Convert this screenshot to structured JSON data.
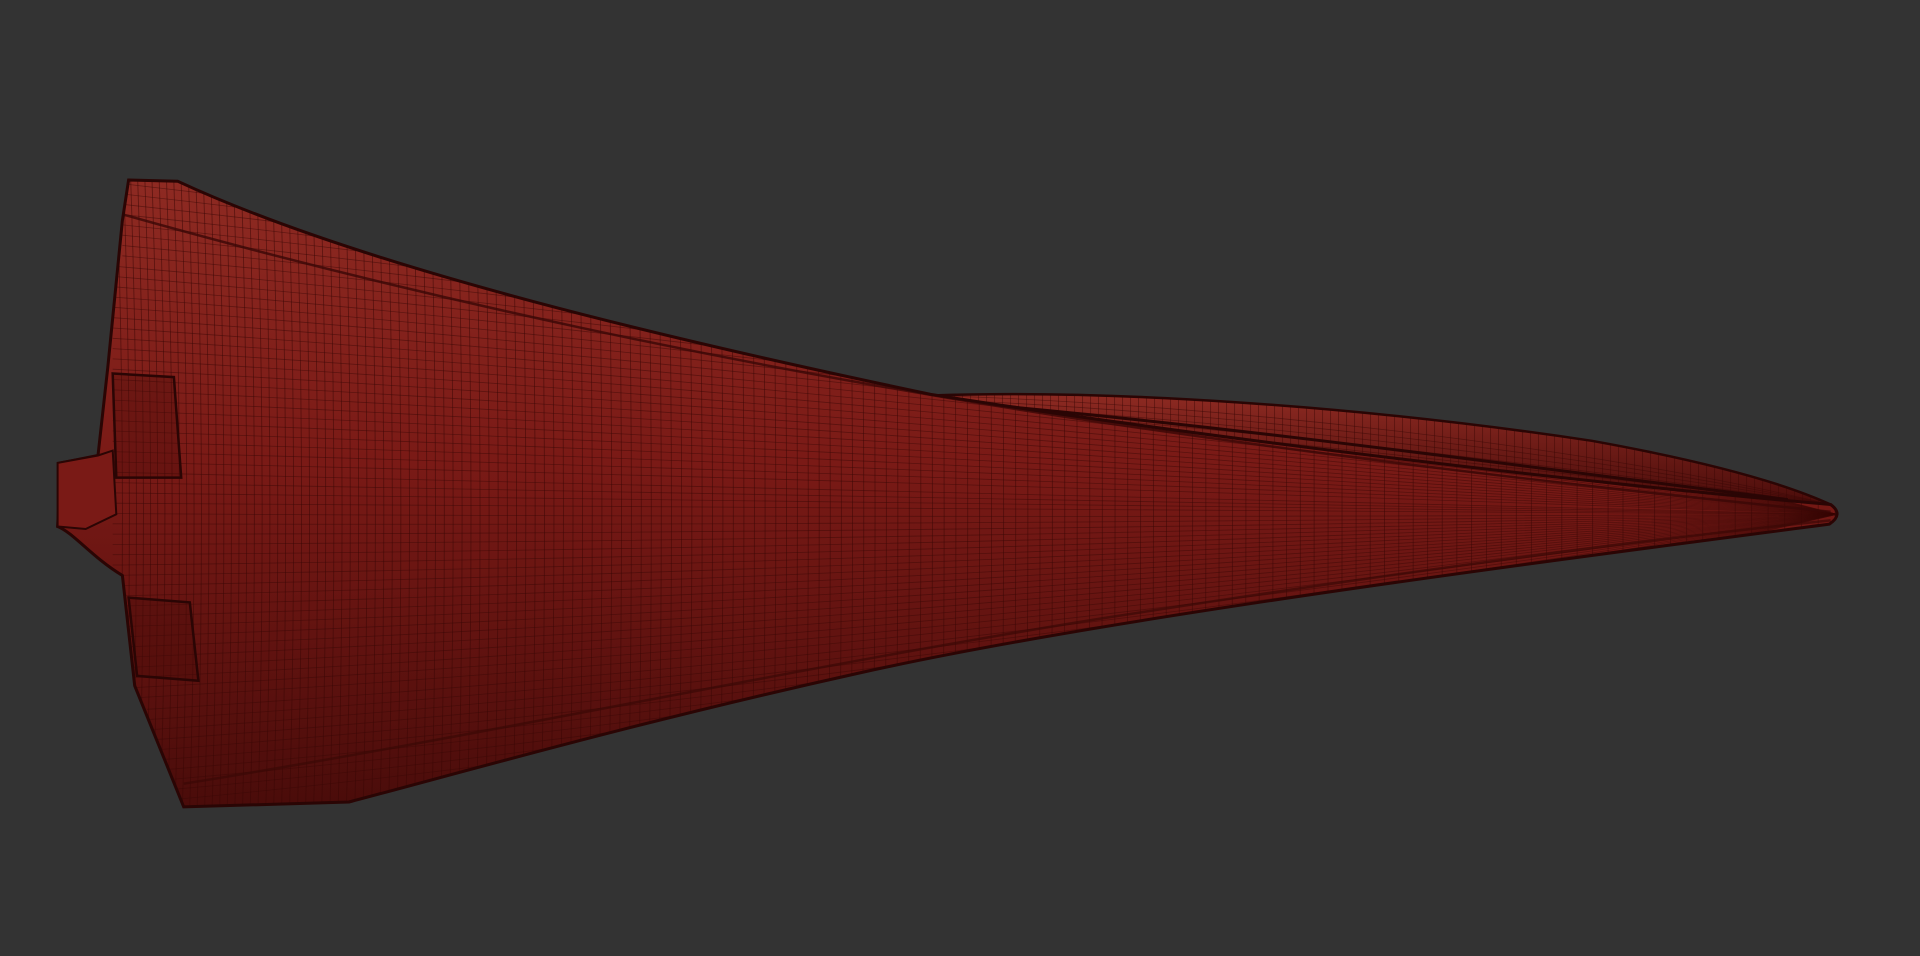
{
  "viewport": {
    "background_color": "#333333"
  },
  "model": {
    "subject": "aircraft-hull-mesh",
    "view": "top",
    "render_mode": "wireframe-on-shaded",
    "surface_color": "#7a1a16",
    "highlight_color": "#8e2a22",
    "shadow_color": "#4a0c0a",
    "wire_color": "#3a0806",
    "outline_color": "#2a0504"
  }
}
